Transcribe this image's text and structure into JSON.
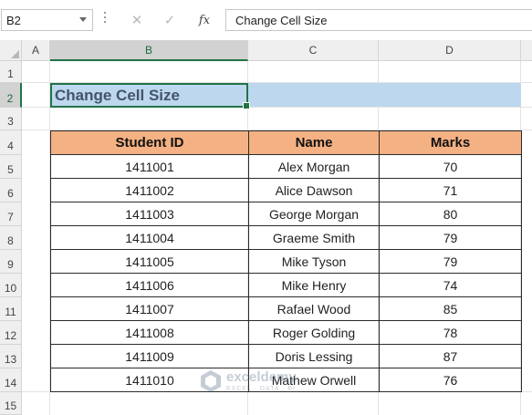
{
  "formula_bar": {
    "name_box": "B2",
    "cancel_icon": "✕",
    "enter_icon": "✓",
    "fx_label": "fx",
    "formula_value": "Change Cell Size"
  },
  "columns": [
    "A",
    "B",
    "C",
    "D"
  ],
  "rows": [
    "1",
    "2",
    "3",
    "4",
    "5",
    "6",
    "7",
    "8",
    "9",
    "10",
    "11",
    "12",
    "13",
    "14",
    "15"
  ],
  "title": "Change Cell Size",
  "table": {
    "headers": [
      "Student ID",
      "Name",
      "Marks"
    ],
    "rows": [
      [
        "1411001",
        "Alex Morgan",
        "70"
      ],
      [
        "1411002",
        "Alice Dawson",
        "71"
      ],
      [
        "1411003",
        "George Morgan",
        "80"
      ],
      [
        "1411004",
        "Graeme Smith",
        "79"
      ],
      [
        "1411005",
        "Mike Tyson",
        "79"
      ],
      [
        "1411006",
        "Mike Henry",
        "74"
      ],
      [
        "1411007",
        "Rafael Wood",
        "85"
      ],
      [
        "1411008",
        "Roger Golding",
        "78"
      ],
      [
        "1411009",
        "Doris Lessing",
        "87"
      ],
      [
        "1411010",
        "Mathew Orwell",
        "76"
      ]
    ]
  },
  "watermark": {
    "name": "exceldemy",
    "tagline": "EXCEL · DATA · BI"
  },
  "colors": {
    "accent": "#217346",
    "header_fill": "#f4b183",
    "title_fill": "#bdd7ee",
    "title_text": "#44546a"
  }
}
